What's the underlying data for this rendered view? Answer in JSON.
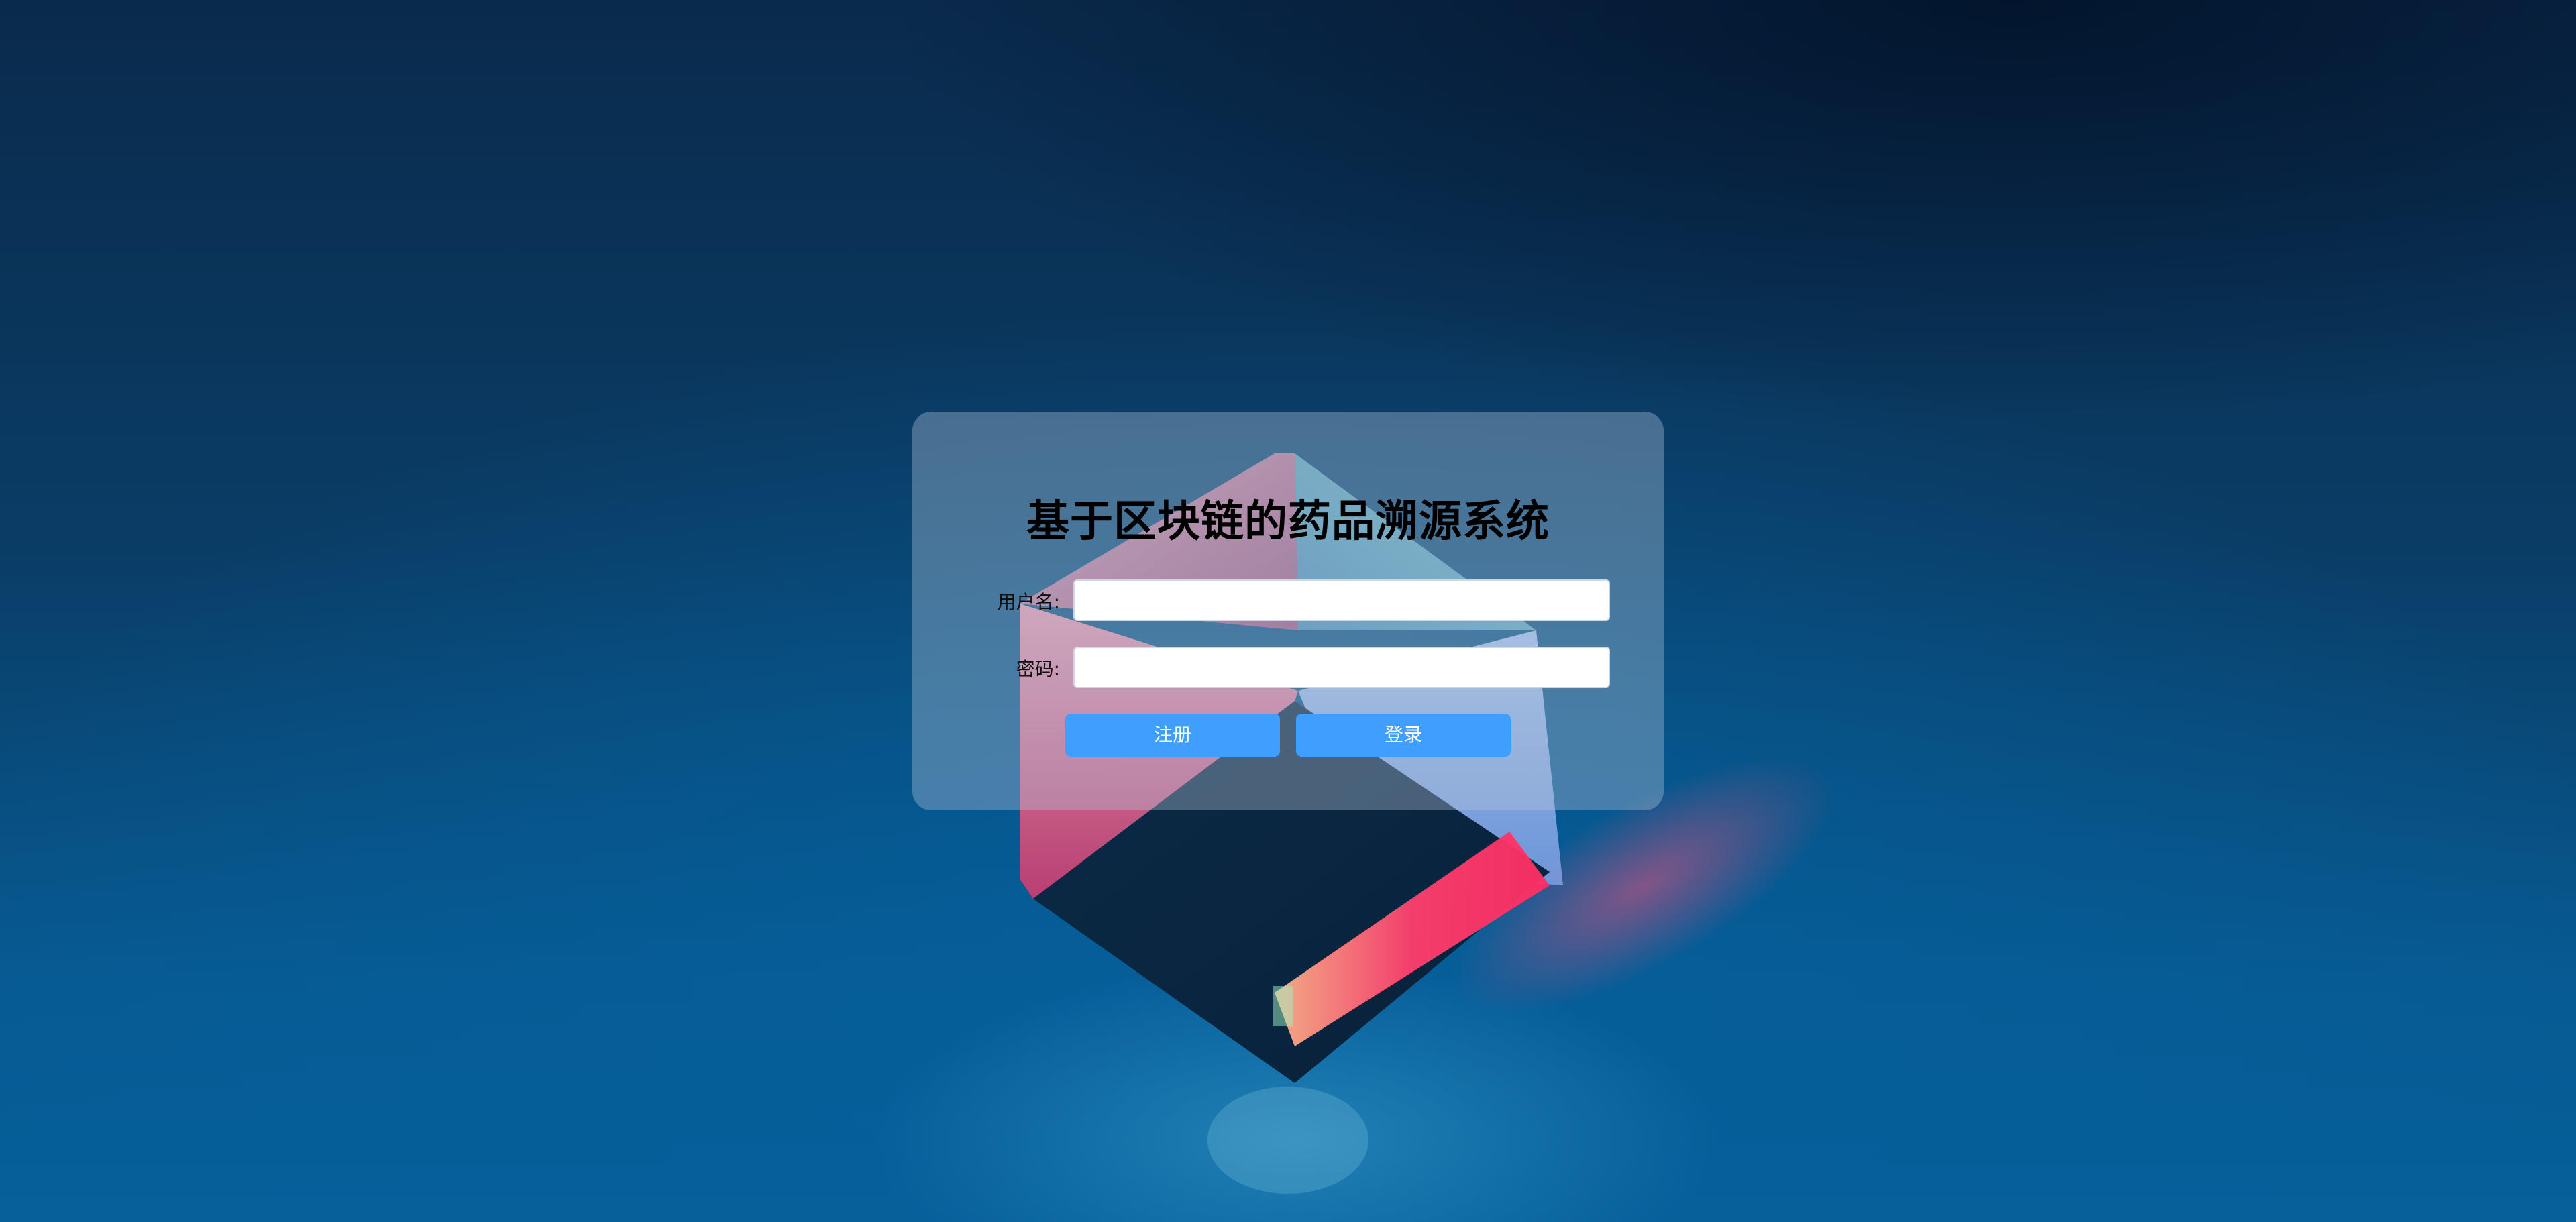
{
  "login": {
    "title": "基于区块链的药品溯源系统",
    "username_label": "用户名:",
    "username_value": "",
    "password_label": "密码:",
    "password_value": "",
    "register_label": "注册",
    "login_label": "登录"
  },
  "colors": {
    "button": "#409eff",
    "button_text": "#ffffff",
    "title_text": "#000000"
  }
}
